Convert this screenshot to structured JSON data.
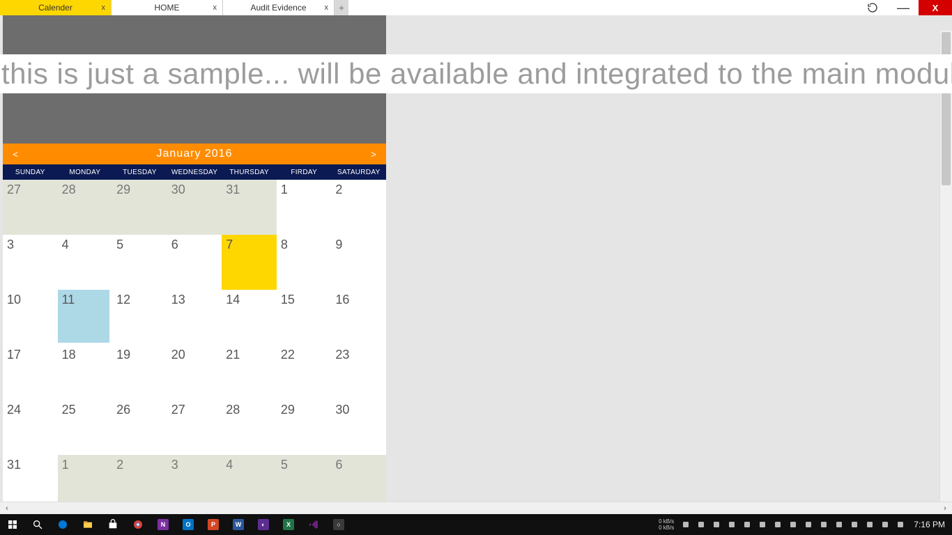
{
  "tabs": [
    {
      "label": "Calender",
      "active": true
    },
    {
      "label": "HOME",
      "active": false
    },
    {
      "label": "Audit Evidence",
      "active": false
    }
  ],
  "tab_close_glyph": "x",
  "newtab_glyph": "+",
  "window_controls": {
    "refresh": "↻",
    "minimize": "—",
    "close": "X"
  },
  "banner_text": "this is just a sample... will be available and integrated to the main module soo",
  "calendar": {
    "prev": "<",
    "next": ">",
    "title": "January  2016",
    "dow": [
      "SUNDAY",
      "MONDAY",
      "TUESDAY",
      "WEDNESDAY",
      "THURSDAY",
      "FIRDAY",
      "SATAURDAY"
    ],
    "cells": [
      {
        "n": "27",
        "outside": true
      },
      {
        "n": "28",
        "outside": true
      },
      {
        "n": "29",
        "outside": true
      },
      {
        "n": "30",
        "outside": true
      },
      {
        "n": "31",
        "outside": true
      },
      {
        "n": "1"
      },
      {
        "n": "2"
      },
      {
        "n": "3"
      },
      {
        "n": "4"
      },
      {
        "n": "5"
      },
      {
        "n": "6"
      },
      {
        "n": "7",
        "today": true
      },
      {
        "n": "8"
      },
      {
        "n": "9"
      },
      {
        "n": "10"
      },
      {
        "n": "11",
        "selected": true
      },
      {
        "n": "12"
      },
      {
        "n": "13"
      },
      {
        "n": "14"
      },
      {
        "n": "15"
      },
      {
        "n": "16"
      },
      {
        "n": "17"
      },
      {
        "n": "18"
      },
      {
        "n": "19"
      },
      {
        "n": "20"
      },
      {
        "n": "21"
      },
      {
        "n": "22"
      },
      {
        "n": "23"
      },
      {
        "n": "24"
      },
      {
        "n": "25"
      },
      {
        "n": "26"
      },
      {
        "n": "27"
      },
      {
        "n": "28"
      },
      {
        "n": "29"
      },
      {
        "n": "30"
      },
      {
        "n": "31"
      },
      {
        "n": "1",
        "outside": true
      },
      {
        "n": "2",
        "outside": true
      },
      {
        "n": "3",
        "outside": true
      },
      {
        "n": "4",
        "outside": true
      },
      {
        "n": "5",
        "outside": true
      },
      {
        "n": "6",
        "outside": true
      }
    ]
  },
  "hscroll": {
    "left": "‹",
    "right": "›"
  },
  "net_stat": {
    "up": "0 kB/s",
    "down": "0 kB/s"
  },
  "clock": "7:16 PM",
  "taskbar_apps": [
    {
      "name": "start-icon",
      "kind": "win"
    },
    {
      "name": "search-icon",
      "kind": "search"
    },
    {
      "name": "edge-icon",
      "kind": "edge"
    },
    {
      "name": "file-explorer-icon",
      "kind": "explorer"
    },
    {
      "name": "store-icon",
      "kind": "store"
    },
    {
      "name": "chrome-icon",
      "kind": "chrome"
    },
    {
      "name": "onenote-icon",
      "kind": "tile",
      "bg": "#7b2fa0",
      "txt": "N"
    },
    {
      "name": "outlook-icon",
      "kind": "tile",
      "bg": "#0072c6",
      "txt": "O"
    },
    {
      "name": "powerpoint-icon",
      "kind": "tile",
      "bg": "#d24726",
      "txt": "P"
    },
    {
      "name": "word-icon",
      "kind": "tile",
      "bg": "#2b579a",
      "txt": "W"
    },
    {
      "name": "app-icon-1",
      "kind": "tile",
      "bg": "#5c2d91",
      "txt": "◐"
    },
    {
      "name": "excel-icon",
      "kind": "tile",
      "bg": "#217346",
      "txt": "X"
    },
    {
      "name": "visual-studio-icon",
      "kind": "vs"
    },
    {
      "name": "app-icon-2",
      "kind": "tile",
      "bg": "#3a3a3a",
      "txt": "○"
    }
  ],
  "tray_icons": [
    "chevron-up-icon",
    "shield-icon",
    "nvidia-icon",
    "note-icon",
    "sync-icon",
    "disk-icon",
    "monitor-icon",
    "power-icon",
    "keyboard-icon",
    "bluetooth-icon",
    "battery-icon",
    "volume-icon",
    "wifi-icon",
    "keyboard-lang-icon",
    "action-center-icon"
  ]
}
